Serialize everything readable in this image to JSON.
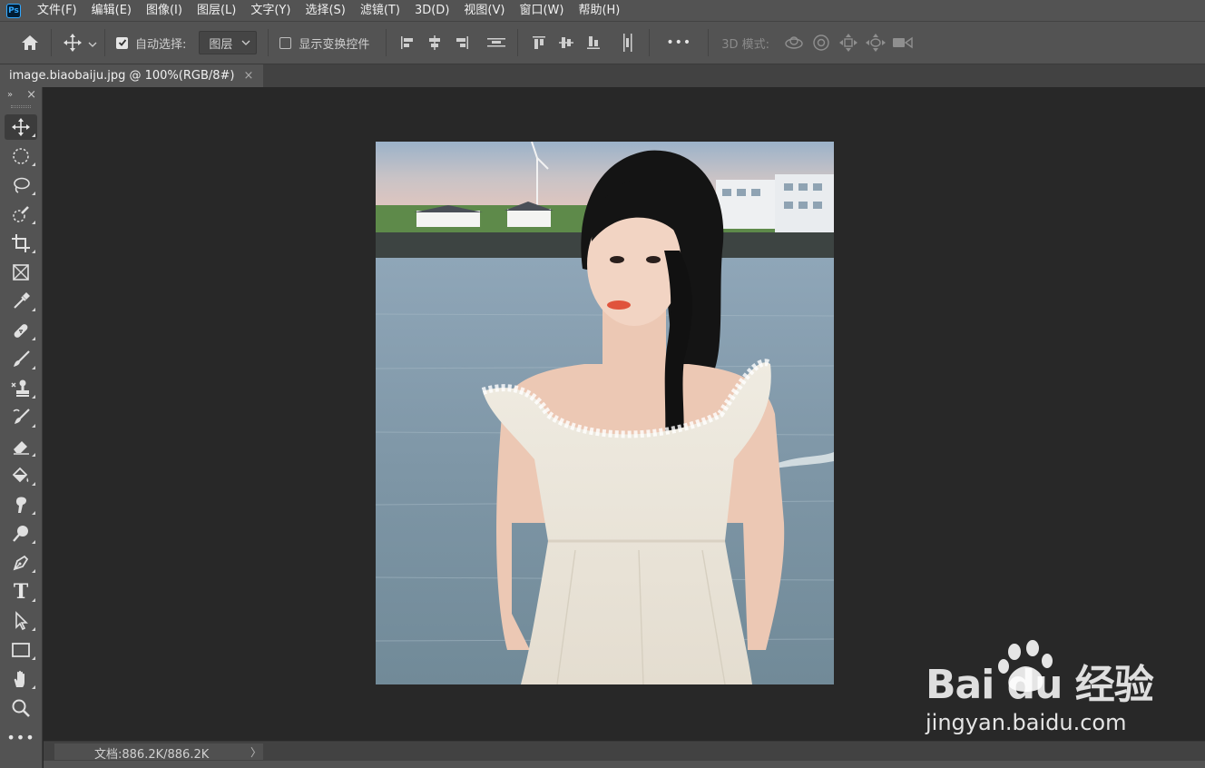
{
  "app": {
    "logo_text": "Ps"
  },
  "menu": {
    "items": [
      "文件(F)",
      "编辑(E)",
      "图像(I)",
      "图层(L)",
      "文字(Y)",
      "选择(S)",
      "滤镜(T)",
      "3D(D)",
      "视图(V)",
      "窗口(W)",
      "帮助(H)"
    ]
  },
  "options": {
    "auto_select_label": "自动选择:",
    "auto_select_checked": true,
    "auto_select_target": "图层",
    "transform_controls_label": "显示变换控件",
    "transform_controls_checked": false,
    "more_label": "•••",
    "mode_label": "3D 模式:",
    "icons": [
      "home-icon",
      "move-icon",
      "align-left-icon",
      "align-center-h-icon",
      "align-right-icon",
      "distribute-h-icon",
      "align-top-icon",
      "align-middle-v-icon",
      "align-bottom-icon",
      "distribute-v-icon",
      "orbit-3d-icon",
      "roll-3d-icon",
      "pan-3d-icon",
      "slide-3d-icon",
      "zoom-3d-camera-icon"
    ]
  },
  "document": {
    "tab_title": "image.biaobaiju.jpg @ 100%(RGB/8#)",
    "close_glyph": "×"
  },
  "toolbar": {
    "collapse_glyph": "»",
    "close_glyph": "×",
    "tools": [
      "move",
      "marquee",
      "lasso",
      "quick-selection",
      "crop",
      "frame",
      "eyedropper",
      "healing-brush",
      "brush",
      "clone-stamp",
      "history-brush",
      "eraser",
      "paint-bucket",
      "smudge",
      "dodge",
      "pen",
      "type",
      "path-selection",
      "rectangle",
      "hand",
      "zoom",
      "more"
    ],
    "active_tool": "move",
    "type_tool_glyph": "T",
    "more_glyph": "•••"
  },
  "status": {
    "doc_size": "文档:886.2K/886.2K",
    "arrow": "〉"
  },
  "watermark": {
    "brand": "Bai  du 经验",
    "url": "jingyan.baidu.com"
  },
  "colors": {
    "panel": "#535353",
    "canvas_bg": "#282828",
    "ps_blue": "#31a8ff"
  }
}
